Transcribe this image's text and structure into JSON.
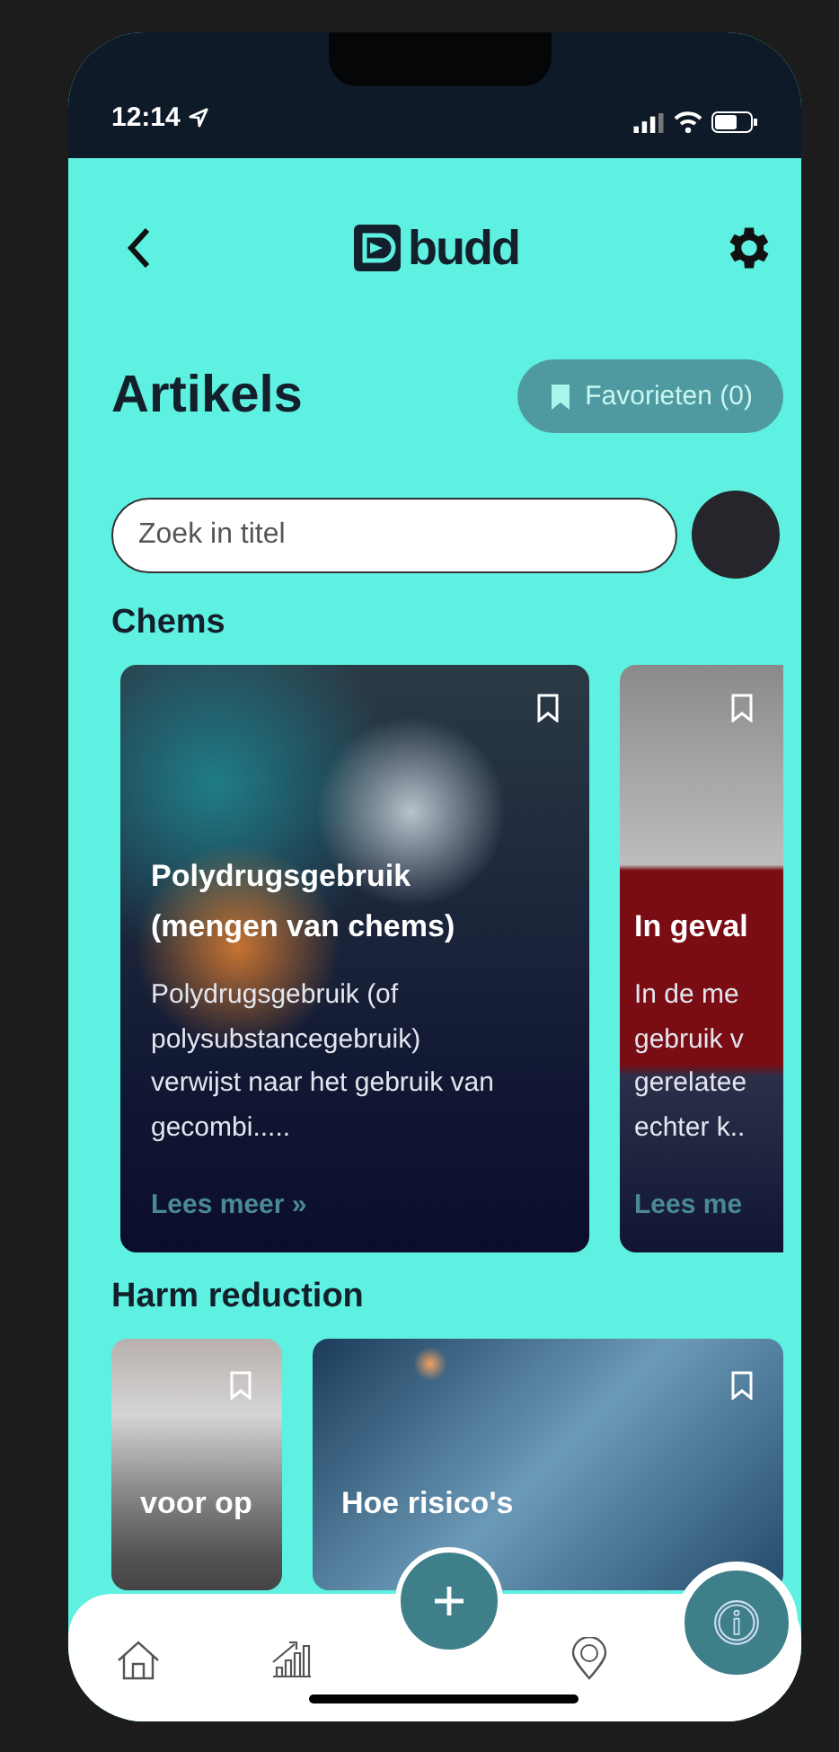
{
  "status_bar": {
    "time": "12:14"
  },
  "header": {
    "logo": "budd"
  },
  "page": {
    "title": "Artikels",
    "favorites_button": "Favorieten (0)"
  },
  "search": {
    "placeholder": "Zoek in titel"
  },
  "sections": [
    {
      "title": "Chems",
      "kind": "tall",
      "articles": [
        {
          "title": "Polydrugsgebruik (mengen van chems)",
          "excerpt": "Polydrugsgebruik (of polysubstancegebruik) verwijst naar het gebruik van gecombi.....",
          "link": "Lees meer »"
        },
        {
          "title": "In geval",
          "excerpt": "In de me\ngebruik v\ngerelatee\nechter k..",
          "link": "Lees me"
        }
      ]
    },
    {
      "title": "Harm reduction",
      "kind": "short",
      "articles": [
        {
          "title": "voor op"
        },
        {
          "title": "Hoe risico's"
        }
      ]
    }
  ]
}
